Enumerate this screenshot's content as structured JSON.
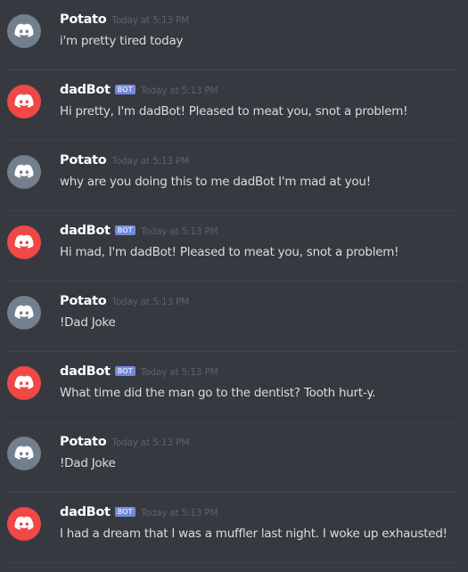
{
  "colors": {
    "background": "#36393f",
    "user_avatar": "#747f8d",
    "bot_avatar": "#f04747",
    "bot_tag": "#7289da"
  },
  "messages": [
    {
      "author": "Potato",
      "bot": false,
      "avatar_icon": "discord-logo-icon",
      "timestamp": "Today at 5:13 PM",
      "content": "i'm pretty tired today"
    },
    {
      "author": "dadBot",
      "bot": true,
      "bot_tag": "BOT",
      "avatar_icon": "discord-logo-icon",
      "timestamp": "Today at 5:13 PM",
      "content": "Hi pretty, I'm dadBot!  Pleased to meat you, snot a problem!"
    },
    {
      "author": "Potato",
      "bot": false,
      "avatar_icon": "discord-logo-icon",
      "timestamp": "Today at 5:13 PM",
      "content": "why are you doing this to me dadBot I'm mad at you!"
    },
    {
      "author": "dadBot",
      "bot": true,
      "bot_tag": "BOT",
      "avatar_icon": "discord-logo-icon",
      "timestamp": "Today at 5:13 PM",
      "content": "Hi mad, I'm dadBot!  Pleased to meat you, snot a problem!"
    },
    {
      "author": "Potato",
      "bot": false,
      "avatar_icon": "discord-logo-icon",
      "timestamp": "Today at 5:13 PM",
      "content": "!Dad Joke"
    },
    {
      "author": "dadBot",
      "bot": true,
      "bot_tag": "BOT",
      "avatar_icon": "discord-logo-icon",
      "timestamp": "Today at 5:13 PM",
      "content": "What time did the man go to the dentist? Tooth hurt-y."
    },
    {
      "author": "Potato",
      "bot": false,
      "avatar_icon": "discord-logo-icon",
      "timestamp": "Today at 5:13 PM",
      "content": "!Dad Joke"
    },
    {
      "author": "dadBot",
      "bot": true,
      "bot_tag": "BOT",
      "avatar_icon": "discord-logo-icon",
      "timestamp": "Today at 5:13 PM",
      "content": "I had a dream that I was a muffler last night. I woke up exhausted!"
    }
  ]
}
